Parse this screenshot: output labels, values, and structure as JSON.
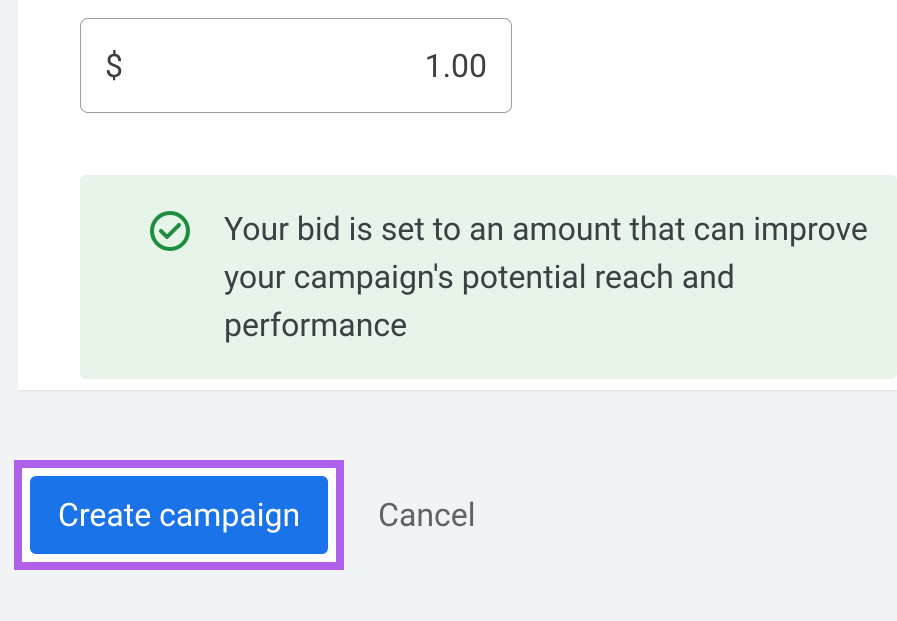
{
  "bid": {
    "currency_symbol": "$",
    "value": "1.00"
  },
  "message": {
    "text": "Your bid is set to an amount that can improve your campaign's potential reach and performance"
  },
  "actions": {
    "create_label": "Create campaign",
    "cancel_label": "Cancel"
  }
}
